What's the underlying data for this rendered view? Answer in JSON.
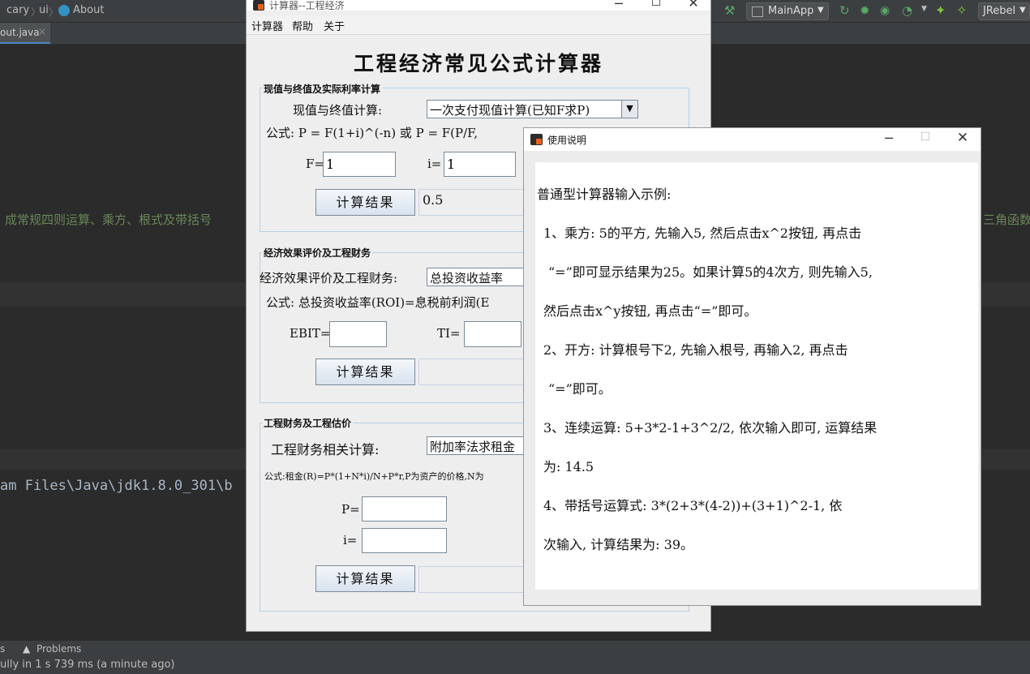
{
  "ide": {
    "breadcrumb": [
      "cary",
      "ui",
      "About"
    ],
    "run_config": "MainApp",
    "jrebel": "JRebel",
    "file_tab": "out.java",
    "file_tab_close": "×",
    "editor_left_text": "成常规四则运算、乘方、根式及带括号",
    "editor_right_text": "三角函数",
    "console_path": "am Files\\Java\\jdk1.8.0_301\\b",
    "status_tab_left": "s",
    "status_tab_problems": "Problems",
    "status_message": "ully in 1 s 739 ms (a minute ago)"
  },
  "calc": {
    "title": "计算器--工程经济",
    "menu": [
      "计算器",
      "帮助",
      "关于"
    ],
    "heading": "工程经济常见公式计算器",
    "group1": {
      "label": "现值与终值及实际利率计算",
      "combo_label": "现值与终值计算:",
      "combo_value": "一次支付现值计算(已知F求P)",
      "formula": "公式: P = F(1+i)^(-n) 或 P = F(P/F,",
      "f_label": "F=",
      "f_value": "1",
      "i_label": "i=",
      "i_value": "1",
      "button": "计算结果",
      "result": "0.5"
    },
    "group2": {
      "label": "经济效果评价及工程财务",
      "combo_label": "经济效果评价及工程财务:",
      "combo_value": "总投资收益率",
      "formula": "公式: 总投资收益率(ROI)=息税前利润(E",
      "ebit_label": "EBIT=",
      "ebit_value": "",
      "ti_label": "TI=",
      "ti_value": "",
      "button": "计算结果",
      "result": ""
    },
    "group3": {
      "label": "工程财务及工程估价",
      "combo_label": "工程财务相关计算:",
      "combo_value": "附加率法求租金",
      "formula": "公式:租金(R)=P*(1+N*i)/N+P*r,P为资产的价格,N为",
      "p_label": "P=",
      "p_value": "",
      "i_label": "i=",
      "i_value": "",
      "button": "计算结果",
      "result": ""
    }
  },
  "help": {
    "title": "使用说明",
    "lines": [
      "普通型计算器输入示例:",
      "1、乘方: 5的平方, 先输入5, 然后点击x^2按钮, 再点击",
      "“=”即可显示结果为25。如果计算5的4次方, 则先输入5,",
      "然后点击x^y按钮, 再点击“=”即可。",
      "2、开方: 计算根号下2, 先输入根号, 再输入2, 再点击",
      "“=”即可。",
      "3、连续运算: 5+3*2-1+3^2/2, 依次输入即可, 运算结果",
      "为: 14.5",
      "4、带括号运算式: 3*(2+3*(4-2))+(3+1)^2-1, 依",
      "次输入, 计算结果为: 39。"
    ]
  },
  "colors": {
    "ide_bg": "#2b2b2b",
    "ide_panel": "#3c3f41",
    "window_bg": "#eeeeee",
    "group_border": "#b8cfe5",
    "app_icon": "#e8601c"
  }
}
